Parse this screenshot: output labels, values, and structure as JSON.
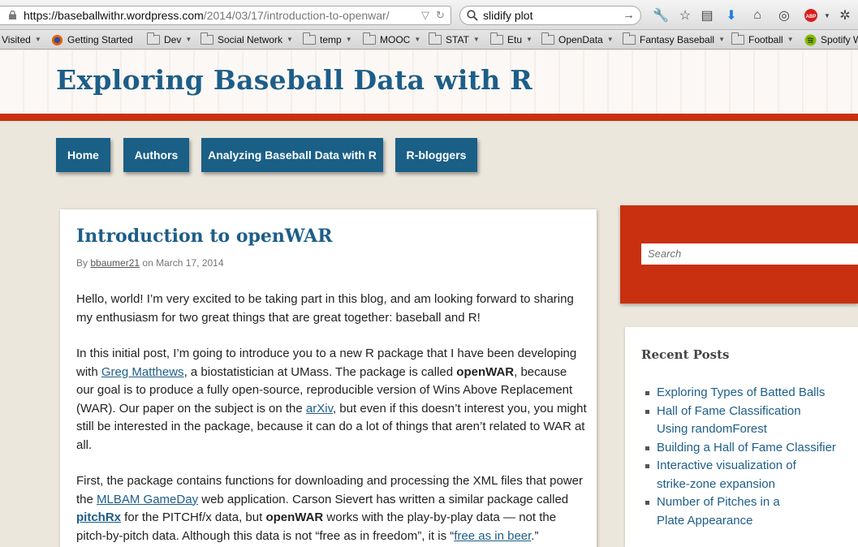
{
  "browser": {
    "url_host": "https://baseballwithr.wordpress.com",
    "url_path": "/2014/03/17/introduction-to-openwar/",
    "search_value": "slidify plot",
    "bookmarks": [
      "Visited",
      "Getting Started",
      "Dev",
      "Social Network",
      "temp",
      "MOOC",
      "STAT",
      "Etu",
      "OpenData",
      "Fantasy Baseball",
      "Football",
      "Spotify W"
    ]
  },
  "site": {
    "title": "Exploring Baseball Data with R",
    "nav": [
      "Home",
      "Authors",
      "Analyzing Baseball Data with R",
      "R-bloggers"
    ]
  },
  "post": {
    "title": "Introduction to openWAR",
    "by": "By",
    "author": "bbaumer21",
    "on": "on",
    "date": "March 17, 2014",
    "p1": "Hello, world! I’m very excited to be taking part in this blog, and am looking forward to sharing my enthusiasm for two great things that are great together: baseball and R!",
    "p2": {
      "a": "In this initial post, I’m going to introduce you to a new R package that I have been developing with ",
      "link1": "Greg Matthews",
      "b": ", a biostatistician at UMass. The package is called ",
      "bold1": "openWAR",
      "c": ", because our goal is to produce a fully open-source, reproducible version of Wins Above Replacement (WAR). Our paper on the subject is on the ",
      "link2": "arXiv",
      "d": ", but even if this doesn’t interest you, you might still be interested in the package, because it can do a lot of things that aren’t related to WAR at all."
    },
    "p3": {
      "a": "First, the package contains functions for downloading and processing the XML files that power the ",
      "link1": "MLBAM GameDay",
      "b": " web application. Carson Sievert has written a similar package called ",
      "link2": "pitchRx",
      "c": " for the PITCHf/x data, but ",
      "bold1": "openWAR",
      "d": " works with the play-by-play data — not the pitch-by-pitch data. Although this data is not “free as in freedom”, it is “",
      "link3": "free as in beer",
      "e": ".”"
    }
  },
  "sidebar": {
    "search_placeholder": "Search",
    "recent_title": "Recent Posts",
    "recent_posts": [
      "Exploring Types of Batted Balls",
      "Hall of Fame Classification Using randomForest",
      "Building a Hall of Fame Classifier",
      "Interactive visualization of strike-zone expansion",
      "Number of Pitches in a Plate Appearance"
    ]
  }
}
